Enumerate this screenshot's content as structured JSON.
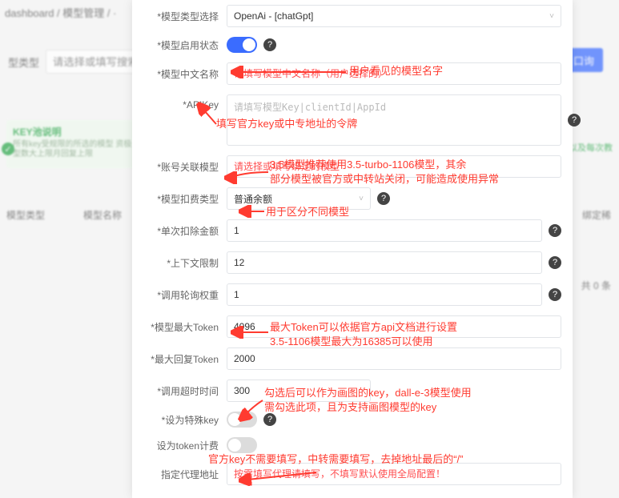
{
  "breadcrumb": "dashboard / 模型管理 / ·",
  "bg_search_label": "型类型",
  "bg_search_placeholder": "请选择或填写搜索项",
  "bg_bluebtn": "口询",
  "bg_notice_title": "KEY池说明",
  "bg_notice_body": "所有key受规限的所选的模型\n资极型数大上限月回复上限",
  "bg_green_side": "以及每次教",
  "bg_thead_left_1": "模型类型",
  "bg_thead_left_2": "模型名称",
  "bg_thead_right": "绑定稀",
  "bg_total": "共 0 条",
  "labels": {
    "type": "模型类型选择",
    "enable": "模型启用状态",
    "cnname": "模型中文名称",
    "apikey": "APIKey",
    "bind": "账号关联模型",
    "fee_type": "模型扣费类型",
    "per_deduct": "单次扣除金额",
    "ctx": "上下文限制",
    "weight": "调用轮询权重",
    "max_token": "模型最大Token",
    "max_reply": "最大回复Token",
    "timeout": "调用超时时间",
    "special": "设为特殊key",
    "token_fee": "设为token计费",
    "proxy": "指定代理地址"
  },
  "values": {
    "type_selected": "OpenAi - [chatGpt]",
    "enable_on": true,
    "cnname_placeholder": "请填写模型中文名称（用户选择的）",
    "apikey_placeholder": "请填写模型Key|clientId|AppId",
    "bind_placeholder": "请选择或填写绑定的模型",
    "fee_type_selected": "普通余额",
    "per_deduct": "1",
    "ctx": "12",
    "weight": "1",
    "max_token": "4096",
    "max_reply": "2000",
    "timeout": "300",
    "special_on": false,
    "token_fee_on": false,
    "proxy_placeholder": "按需填写代理请填写，不填写默认使用全局配置！"
  },
  "annotations": {
    "a_name": "用户看见的模型名字",
    "a_key": "填写官方key或中专地址的令牌",
    "a_bind": "3.5模型推荐使用3.5-turbo-1106模型，其余\n部分模型被官方或中转站关闭，可能造成使用异常",
    "a_fee": "用于区分不同模型",
    "a_maxtok": "最大Token可以依据官方api文档进行设置\n3.5-1106模型最大为16385可以使用",
    "a_special": "勾选后可以作为画图的key，dall-e-3模型使用\n需勾选此项，且为支持画图模型的key",
    "a_proxy": "官方key不需要填写，中转需要填写，去掉地址最后的“/”"
  }
}
